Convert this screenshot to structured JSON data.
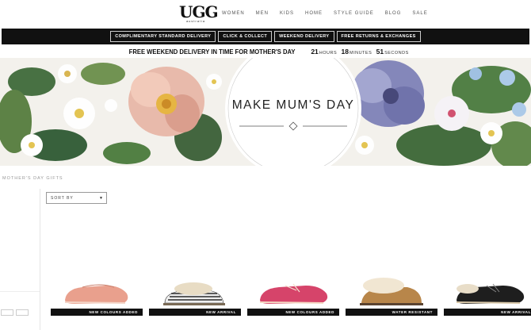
{
  "header": {
    "logo_text": "UGG",
    "logo_sub": "australia",
    "nav": [
      "WOMEN",
      "MEN",
      "KIDS",
      "HOME",
      "STYLE GUIDE",
      "BLOG",
      "SALE"
    ]
  },
  "promo": {
    "buttons": [
      "COMPLIMENTARY STANDARD DELIVERY",
      "CLICK & COLLECT",
      "WEEKEND DELIVERY",
      "FREE RETURNS & EXCHANGES"
    ]
  },
  "countdown": {
    "text": "FREE WEEKEND DELIVERY IN TIME FOR MOTHER'S DAY",
    "hours": "21",
    "hours_label": "HOURS",
    "minutes": "18",
    "minutes_label": "MINUTES",
    "seconds": "51",
    "seconds_label": "SECONDS"
  },
  "hero": {
    "title": "MAKE MUM'S DAY"
  },
  "breadcrumb": "MOTHER'S DAY GIFTS",
  "sort": {
    "label": "SORT BY",
    "arrow_icon": "caret-down-icon"
  },
  "products": [
    {
      "badge": "NEW COLOURS ADDED",
      "color": "#e9a08d"
    },
    {
      "badge": "NEW ARRIVAL",
      "color": "#2a2a2a"
    },
    {
      "badge": "NEW COLOURS ADDED",
      "color": "#d6446a"
    },
    {
      "badge": "WATER RESISTANT",
      "color": "#b8864a"
    },
    {
      "badge": "NEW ARRIVAL",
      "color": "#1e1e1e"
    }
  ],
  "colors": {
    "promo_bg": "#111111",
    "badge_bg": "#111111"
  }
}
